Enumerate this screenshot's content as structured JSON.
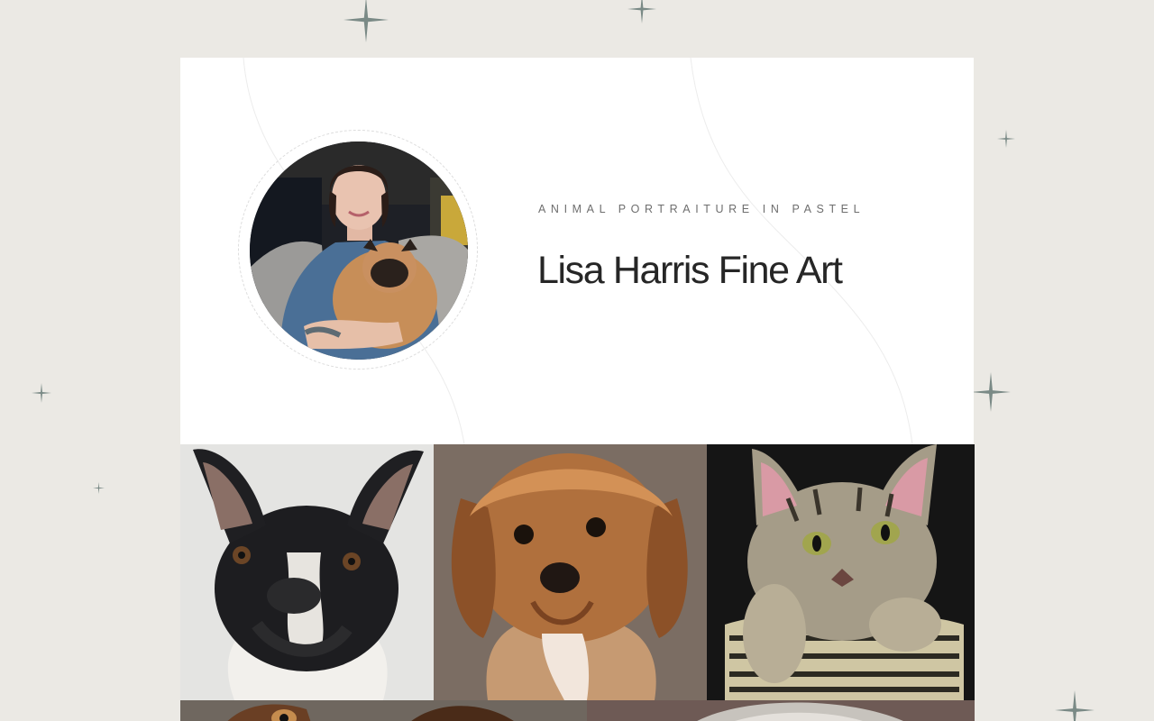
{
  "hero": {
    "eyebrow": "ANIMAL PORTRAITURE IN PASTEL",
    "title": "Lisa Harris Fine Art"
  },
  "avatar": {
    "icon": "artist-portrait-with-pug"
  },
  "gallery": {
    "items": [
      {
        "icon": "french-bulldog-portrait"
      },
      {
        "icon": "cavapoo-dog-portrait"
      },
      {
        "icon": "tabby-cat-portrait"
      },
      {
        "icon": "dog-portrait-partial"
      },
      {
        "icon": "pet-portrait-partial"
      }
    ]
  },
  "colors": {
    "background": "#ebe9e4",
    "card": "#ffffff",
    "sparkle": "#7a8a86",
    "title": "#262626",
    "eyebrow": "#6e6e6e"
  }
}
